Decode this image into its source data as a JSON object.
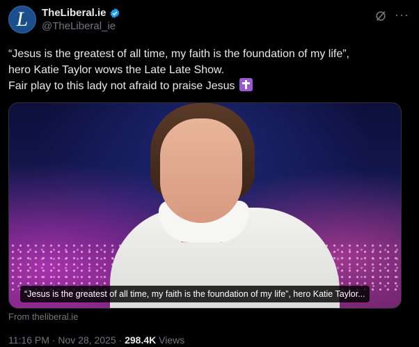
{
  "author": {
    "display_name": "TheLiberal.ie",
    "handle": "@TheLiberal_ie",
    "avatar_letter": "L"
  },
  "tweet": {
    "lines": [
      "“Jesus is the greatest of all time, my faith is the foundation of my life”,",
      "hero Katie Taylor wows the Late Late Show.",
      "Fair play to this lady not afraid to praise Jesus"
    ],
    "emoji": "latin-cross-emoji"
  },
  "media": {
    "caption": "“Jesus is the greatest of all time, my faith is the foundation of my life”, hero Katie Taylor..."
  },
  "source": "From theliberal.ie",
  "meta": {
    "time": "11:16 PM",
    "date": "Nov 28, 2025",
    "separator": "·",
    "views_count": "298.4K",
    "views_label": "Views"
  },
  "colors": {
    "accent": "#1d9bf0",
    "muted": "#71767b",
    "text": "#e7e9ea",
    "background": "#000000"
  }
}
